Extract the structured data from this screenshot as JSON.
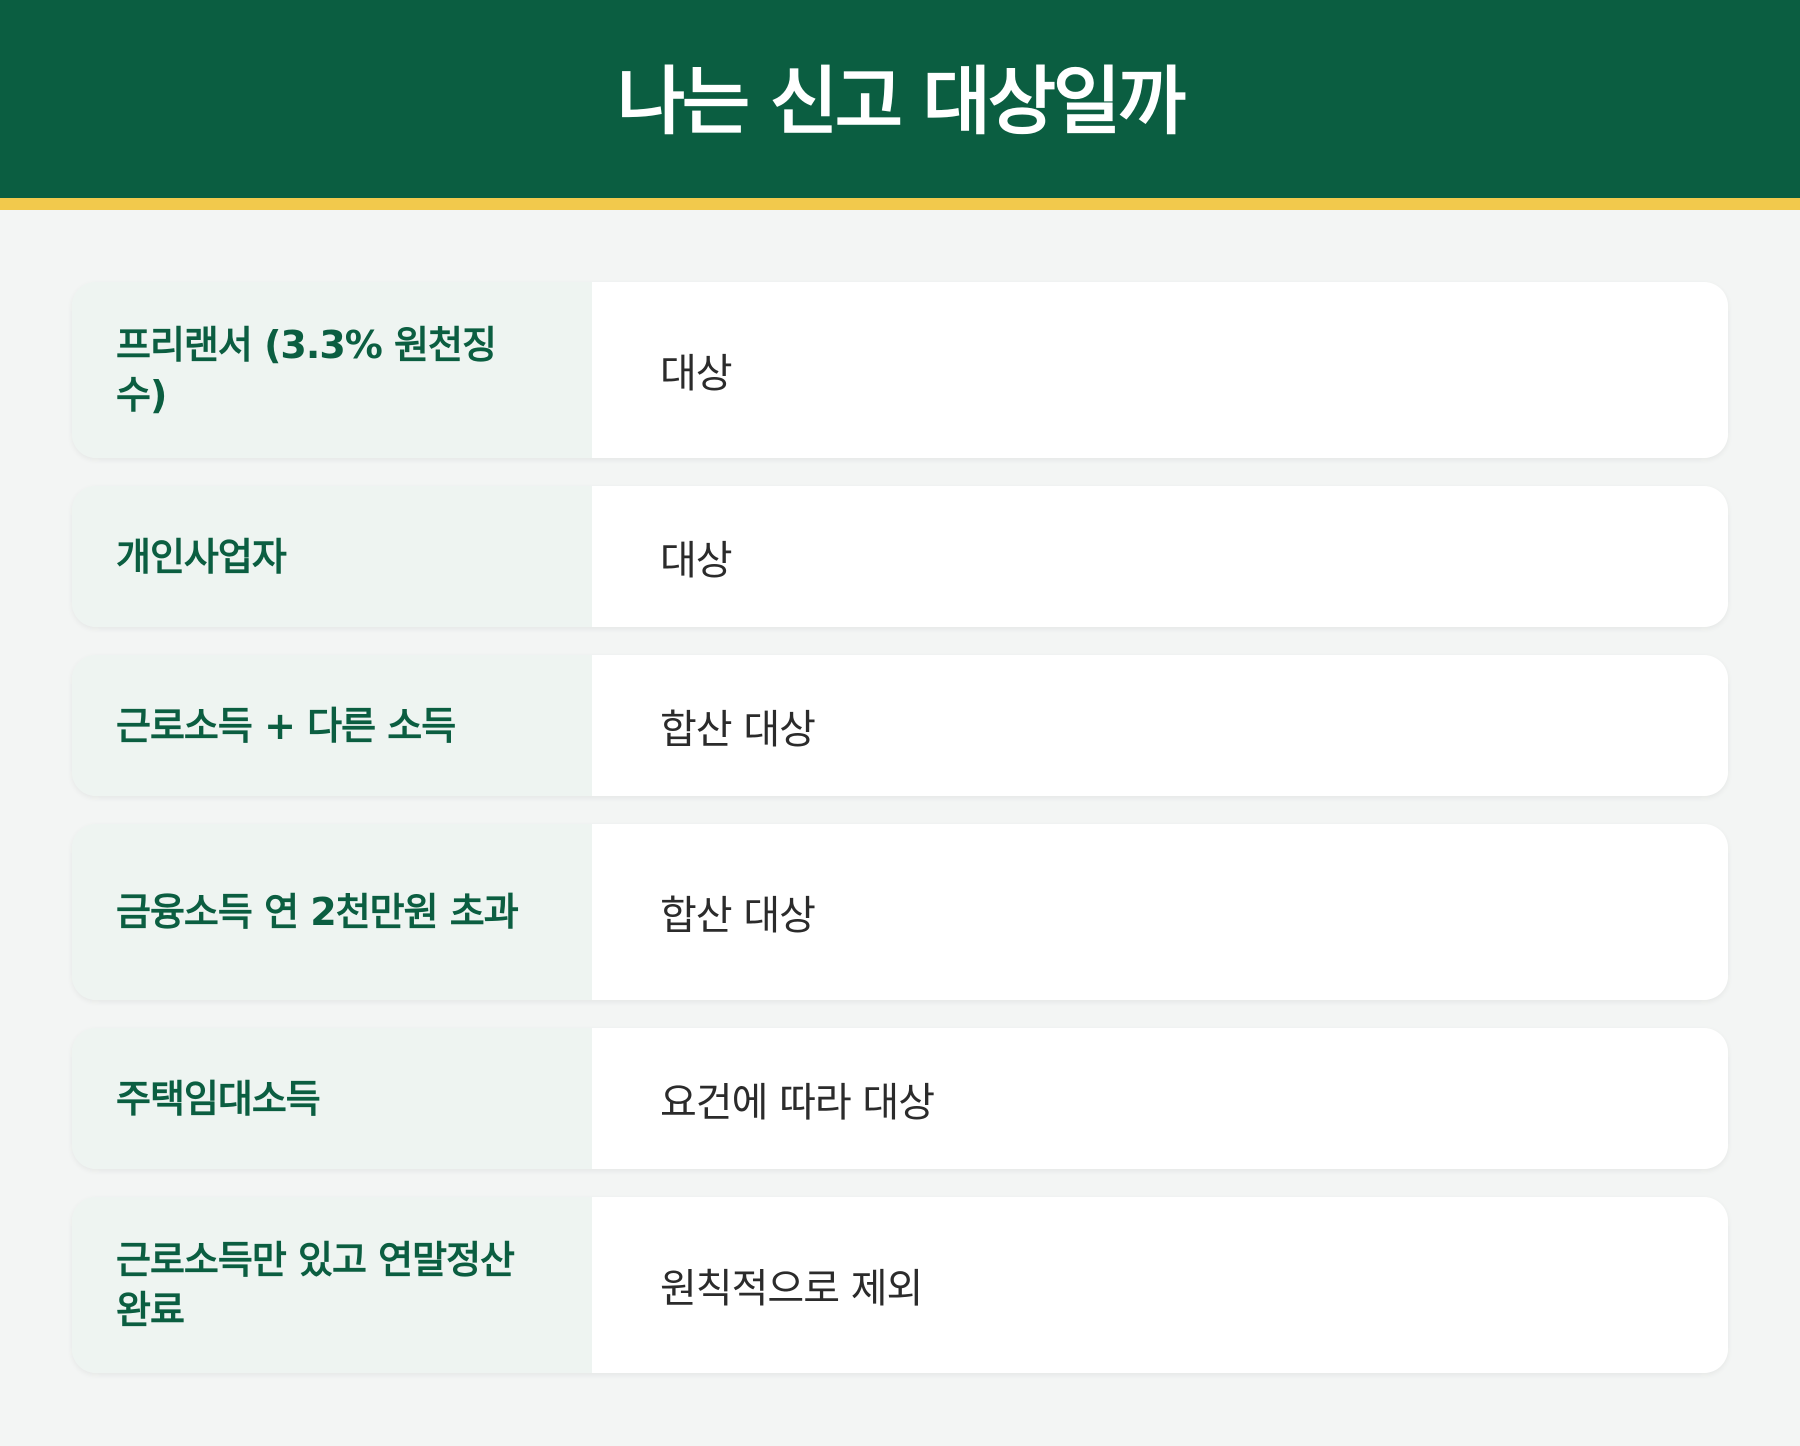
{
  "header": {
    "title": "나는 신고 대상일까"
  },
  "rows": [
    {
      "label": "프리랜서 (3.3% 원천징수)",
      "value": "대상"
    },
    {
      "label": "개인사업자",
      "value": "대상"
    },
    {
      "label": "근로소득 + 다른 소득",
      "value": "합산 대상"
    },
    {
      "label": "금융소득 연 2천만원 초과",
      "value": "합산 대상"
    },
    {
      "label": "주택임대소득",
      "value": "요건에 따라 대상"
    },
    {
      "label": "근로소득만 있고 연말정산 완료",
      "value": "원칙적으로 제외"
    }
  ],
  "colors": {
    "header_bg": "#0b5e41",
    "accent_bar": "#f2c94c",
    "label_text": "#0b5e41",
    "label_bg": "#eef4f1",
    "value_bg": "#ffffff",
    "page_bg": "#f3f5f4"
  }
}
